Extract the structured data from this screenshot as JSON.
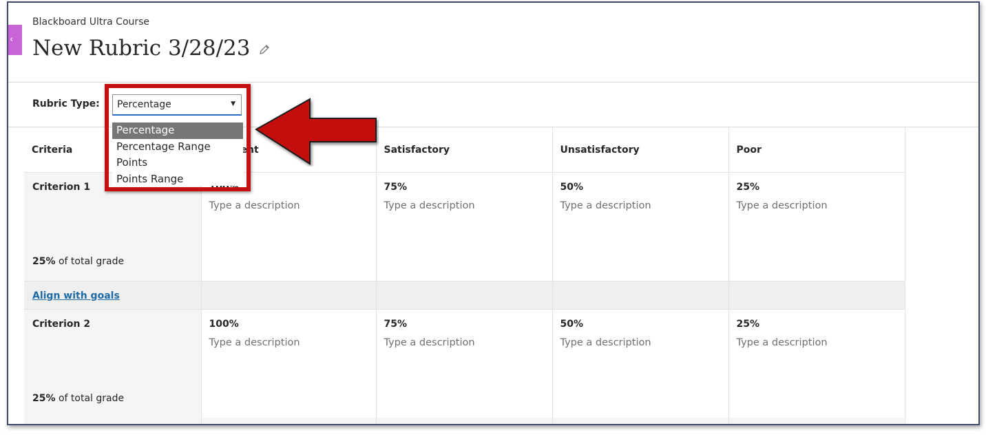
{
  "header": {
    "course_name": "Blackboard Ultra Course",
    "rubric_title": "New Rubric 3/28/23",
    "back_tab_label": "‹"
  },
  "rubric_type": {
    "label": "Rubric Type:",
    "selected": "Percentage",
    "options": [
      "Percentage",
      "Percentage Range",
      "Points",
      "Points Range"
    ]
  },
  "columns": [
    "Criteria",
    "Excellent",
    "Satisfactory",
    "Unsatisfactory",
    "Poor"
  ],
  "criteria": [
    {
      "name": "Criterion 1",
      "weight_bold": "25%",
      "weight_text": " of total grade",
      "cells": [
        {
          "percent": "100%",
          "desc": "Type a description"
        },
        {
          "percent": "75%",
          "desc": "Type a description"
        },
        {
          "percent": "50%",
          "desc": "Type a description"
        },
        {
          "percent": "25%",
          "desc": "Type a description"
        }
      ]
    },
    {
      "name": "Criterion 2",
      "weight_bold": "25%",
      "weight_text": " of total grade",
      "cells": [
        {
          "percent": "100%",
          "desc": "Type a description"
        },
        {
          "percent": "75%",
          "desc": "Type a description"
        },
        {
          "percent": "50%",
          "desc": "Type a description"
        },
        {
          "percent": "25%",
          "desc": "Type a description"
        }
      ]
    }
  ],
  "goals_link": "Align with goals",
  "colors": {
    "accent_purple": "#c964d6",
    "highlight_red": "#c41010",
    "link_blue": "#1d6aa6",
    "selected_option_bg": "#767676"
  },
  "icons": [
    "chevron-left-icon",
    "pencil-icon",
    "caret-down-icon",
    "callout-arrow-icon"
  ]
}
